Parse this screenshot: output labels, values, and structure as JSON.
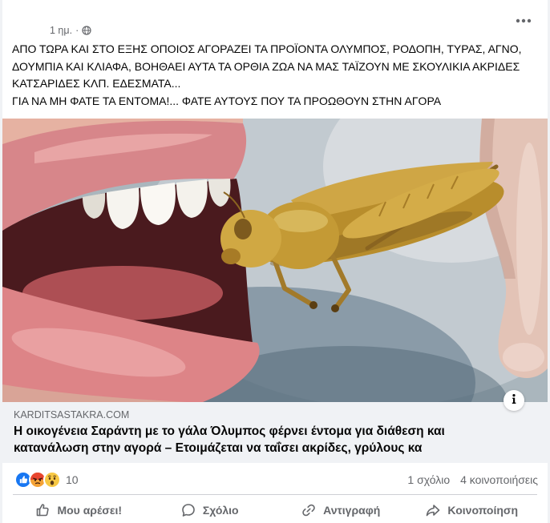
{
  "post": {
    "timestamp": "1 ημ.",
    "separator": "·",
    "privacy_icon": "globe-icon",
    "menu_icon": "more-dots-icon",
    "text_lines": [
      "ΑΠΟ ΤΩΡΑ ΚΑΙ ΣΤΟ ΕΞΗΣ ΟΠΟΙΟΣ ΑΓΟΡΑΖΕΙ ΤΑ ΠΡΟΪΟΝΤΑ ΟΛΥΜΠΟΣ, ΡΟΔΟΠΗ, ΤΥΡΑΣ, ΑΓΝΟ,",
      "ΔΟΥΜΠΙΑ ΚΑΙ ΚΛΙΑΦΑ, ΒΟΗΘΑΕΙ ΑΥΤΑ ΤΑ ΟΡΘΙΑ ΖΩΑ ΝΑ ΜΑΣ ΤΑΪΖΟΥΝ ΜΕ ΣΚΟΥΛΙΚΙΑ ΑΚΡΙΔΕΣ",
      "ΚΑΤΣΑΡΙΔΕΣ ΚΛΠ. ΕΔΕΣΜΑΤΑ...",
      "ΓΙΑ ΝΑ ΜΗ ΦΑΤΕ ΤΑ ΕΝΤΟΜΑ!... ΦΑΤΕ ΑΥΤΟΥΣ ΠΟΥ ΤΑ ΠΡΟΩΘΟΥΝ ΣΤΗΝ ΑΓΟΡΑ"
    ]
  },
  "link_preview": {
    "domain": "KARDITSASTAKRA.COM",
    "title_lines": [
      "Η οικογένεια Σαράντη με το γάλα Όλυμπος φέρνει έντομα για διάθεση και",
      "κατανάλωση στην αγορά – Ετοιμάζεται να ταΐσει ακρίδες, γρύλους κα"
    ],
    "info_icon": "info-icon"
  },
  "reactions": {
    "icons": [
      "like-reaction-icon",
      "angry-reaction-icon",
      "wow-reaction-icon"
    ],
    "count": "10",
    "comments": "1 σχόλιο",
    "shares": "4 κοινοποιήσεις"
  },
  "actions": [
    {
      "label": "Μου αρέσει!",
      "icon": "thumbs-up-icon"
    },
    {
      "label": "Σχόλιο",
      "icon": "comment-icon"
    },
    {
      "label": "Αντιγραφή",
      "icon": "link-icon"
    },
    {
      "label": "Κοινοποίηση",
      "icon": "share-icon"
    }
  ],
  "colors": {
    "primary_text": "#050505",
    "secondary_text": "#65676b",
    "link_box_background": "#f0f2f5",
    "like_blue": "#1877f2",
    "page_background": "#f0f2f5"
  }
}
